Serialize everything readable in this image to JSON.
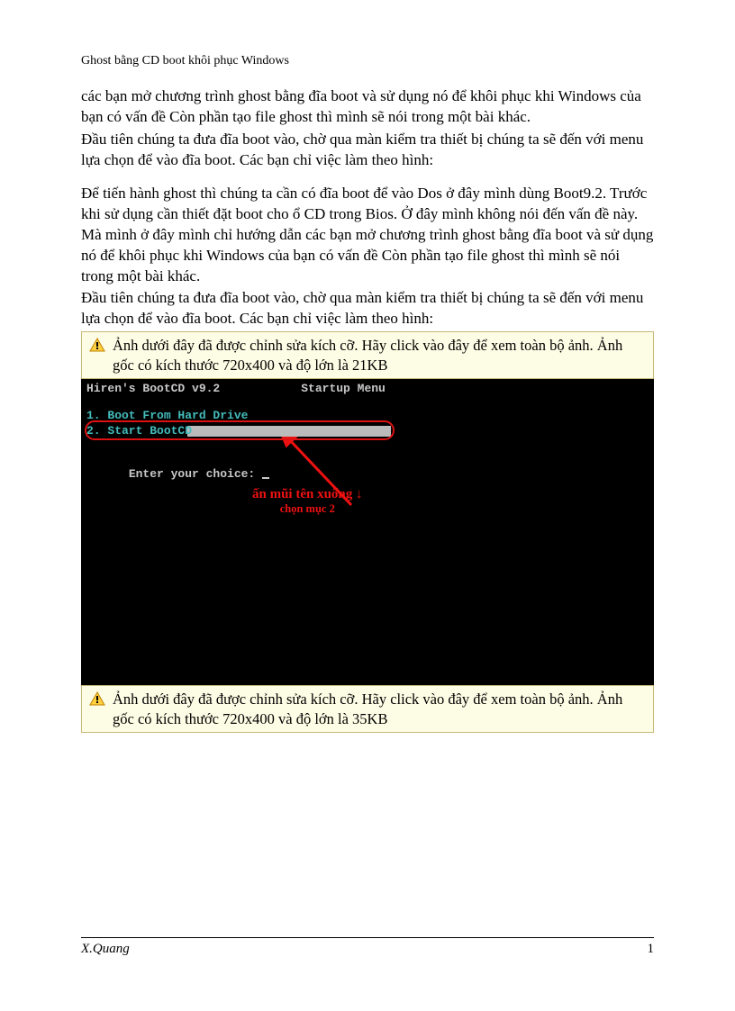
{
  "header": {
    "title": "Ghost bằng CD boot khôi phục Windows"
  },
  "paragraphs": {
    "p1": "các bạn mở chương trình ghost bằng đĩa boot và sử dụng nó để khôi phục khi Windows của bạn có vấn đề Còn phần tạo file ghost thì mình sẽ nói trong một bài khác.",
    "p2": "Đầu tiên chúng ta đưa đĩa boot vào, chờ qua màn kiểm tra thiết bị chúng ta sẽ đến với menu lựa chọn để vào đĩa boot. Các bạn chỉ việc làm theo hình:",
    "p3": "Để tiến hành ghost thì chúng ta cần có đĩa boot để vào Dos ở đây mình dùng Boot9.2. Trước khi sử dụng cần thiết đặt boot cho ổ CD trong Bios. Ở đây mình không nói đến vấn đề này. Mà mình ở đây mình chỉ hướng dẫn các bạn mở chương trình ghost bằng đĩa boot và sử dụng nó để khôi phục khi Windows của bạn có vấn đề Còn phần tạo file ghost thì mình sẽ nói trong một bài khác.",
    "p4": "Đầu tiên chúng ta đưa đĩa boot vào, chờ qua màn kiểm tra thiết bị chúng ta sẽ đến với menu lựa chọn để vào đĩa boot. Các bạn chỉ việc làm theo hình:"
  },
  "notices": {
    "n1": "Ảnh dưới đây đã được chỉnh sửa kích cỡ. Hãy click vào đây để xem toàn bộ ảnh. Ảnh gốc có kích thước 720x400 và độ lớn là 21KB",
    "n2": "Ảnh dưới đây đã được chỉnh sửa kích cỡ. Hãy click vào đây để xem toàn bộ ảnh. Ảnh gốc có kích thước 720x400 và độ lớn là 35KB"
  },
  "terminal": {
    "title_left": "Hiren's BootCD v9.2",
    "title_right": "Startup Menu",
    "opt1": "1. Boot From Hard Drive",
    "opt2": "2. Start BootCD",
    "prompt": "Enter your choice: ",
    "annotation_main": "ấn mũi tên xuống ↓",
    "annotation_sub": "chọn mục 2"
  },
  "footer": {
    "author": "X.Quang",
    "page": "1"
  }
}
